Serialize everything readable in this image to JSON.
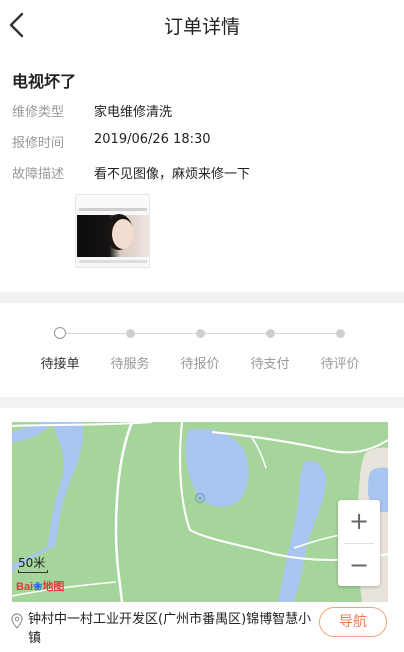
{
  "header": {
    "title": "订单详情"
  },
  "order": {
    "title": "电视坏了",
    "fields": [
      {
        "label": "维修类型",
        "value": "家电维修清洗"
      },
      {
        "label": "报修时间",
        "value": "2019/06/26 18:30"
      },
      {
        "label": "故障描述",
        "value": "看不见图像，麻烦来修一下"
      }
    ]
  },
  "progress": {
    "steps": [
      "待接单",
      "待服务",
      "待报价",
      "待支付",
      "待评价"
    ],
    "current_index": 0
  },
  "map": {
    "scale_label": "50米",
    "logo_text": "Bai",
    "logo_suffix": "地图",
    "zoom_in": "+",
    "zoom_out": "−",
    "colors": {
      "land": "#a5d59a",
      "water": "#a9c6f0",
      "road": "#ffffff"
    }
  },
  "address": {
    "text": "钟村中一村工业开发区(广州市番禺区)锦博智慧小镇",
    "nav_label": "导航",
    "accent": "#ef7c4f"
  }
}
